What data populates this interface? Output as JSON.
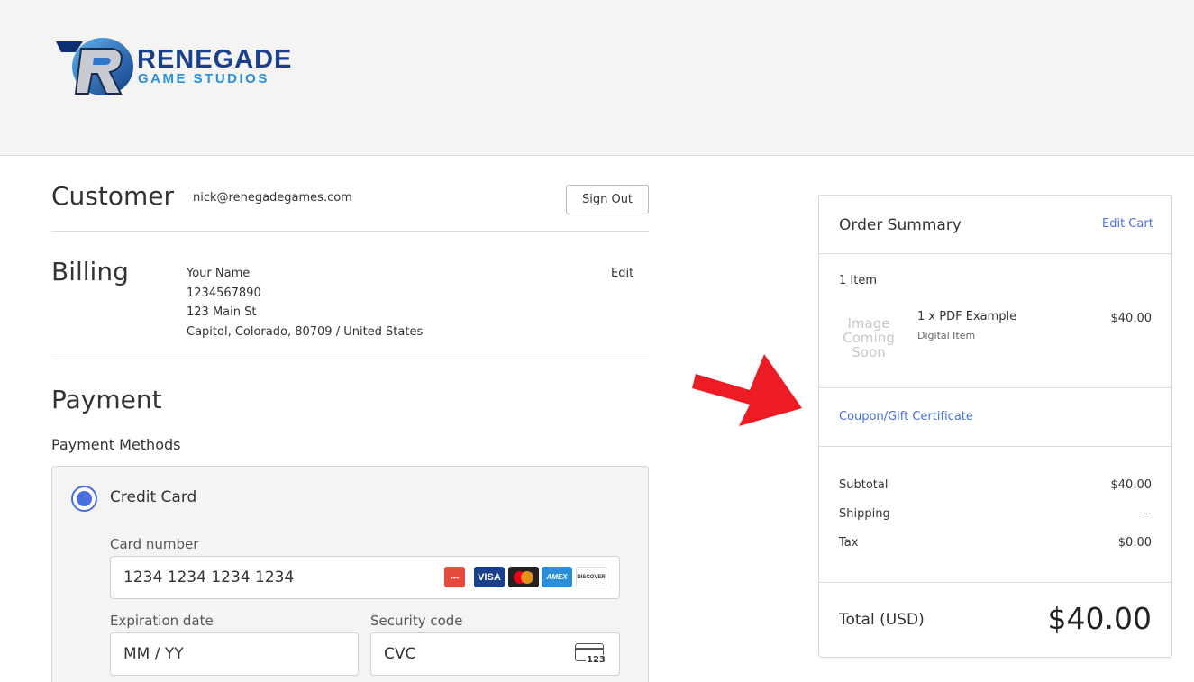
{
  "brand": {
    "line1": "RENEGADE",
    "line2": "GAME STUDIOS",
    "logo_icon": "renegade-r-logo"
  },
  "customer": {
    "title": "Customer",
    "email": "nick@renegadegames.com",
    "sign_out_label": "Sign Out"
  },
  "billing": {
    "title": "Billing",
    "edit_label": "Edit",
    "name": "Your Name",
    "phone": "1234567890",
    "street": "123 Main St",
    "city_line": "Capitol, Colorado, 80709 / United States"
  },
  "payment": {
    "title": "Payment",
    "methods_label": "Payment Methods",
    "method_name": "Credit Card",
    "card_number_label": "Card number",
    "card_number_placeholder": "1234 1234 1234 1234",
    "expiration_label": "Expiration date",
    "expiration_placeholder": "MM / YY",
    "security_label": "Security code",
    "security_placeholder": "CVC",
    "cvc_icon_text": "123",
    "card_brands": [
      "VISA",
      "AMEX",
      "DISCOVER"
    ]
  },
  "order_summary": {
    "title": "Order Summary",
    "edit_cart_label": "Edit Cart",
    "item_count": "1 Item",
    "item": {
      "image_placeholder": "Image Coming Soon",
      "name": "1 x PDF Example",
      "type": "Digital Item",
      "price": "$40.00"
    },
    "coupon_label": "Coupon/Gift Certificate",
    "subtotal_label": "Subtotal",
    "subtotal_value": "$40.00",
    "shipping_label": "Shipping",
    "shipping_value": "--",
    "tax_label": "Tax",
    "tax_value": "$0.00",
    "total_label": "Total (USD)",
    "total_value": "$40.00"
  },
  "colors": {
    "accent": "#4a6fe0",
    "arrow": "#ed1c24",
    "header_bg": "#f4f4f4"
  }
}
